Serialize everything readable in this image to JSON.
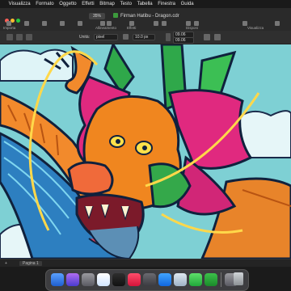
{
  "menubar": {
    "items": [
      "Visualizza",
      "Formato",
      "Oggetto",
      "Effetti",
      "Bitmap",
      "Testo",
      "Tabella",
      "Finestra",
      "Guida"
    ]
  },
  "toolbar": {
    "zoom": "35%",
    "document_title": "Firman Hatibu - Dragon.cdr",
    "labels": {
      "importa": "Importa",
      "allineamento": "Allineamento",
      "effetti": "Effetti",
      "disponi": "Disponi",
      "visualizza": "Visualizza"
    }
  },
  "propbar": {
    "units_label": "Unità:",
    "units_value": "pixel",
    "nudge_value": "10.0 px",
    "dup_x": "09.06",
    "dup_y": "09.06"
  },
  "pagebar": {
    "page_tab": "Pagina 1"
  },
  "colors": {
    "accent_green": "#3c9a3c",
    "canvas_sky": "#7ed0d4"
  }
}
